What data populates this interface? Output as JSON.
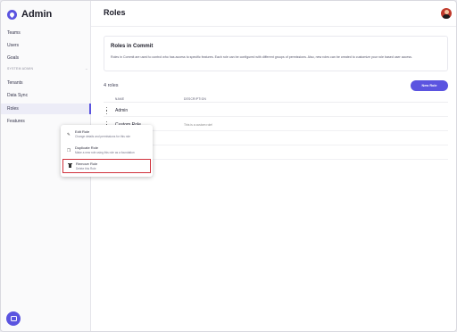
{
  "brand": {
    "name": "Admin"
  },
  "sidebar": {
    "items_top": [
      "Teams",
      "Users",
      "Goals"
    ],
    "section_label": "SYSTEM ADMIN",
    "section_chevron": "–",
    "items_admin": [
      "Tenants",
      "Data Sync",
      "Roles",
      "Features"
    ],
    "active": "Roles"
  },
  "header": {
    "title": "Roles"
  },
  "info_card": {
    "title": "Roles in Commit",
    "description": "Roles in Commit are used to control who has access to specific features. Each role can be configured with different groups of permissions. Also, new roles can be created to customize your role based user access."
  },
  "roles": {
    "count_label": "4 roles",
    "new_button": "New Role",
    "columns": [
      "NAME",
      "DESCRIPTION"
    ],
    "rows": [
      {
        "name": "Admin",
        "description": ""
      },
      {
        "name": "Custom Role",
        "description": "This is a custom role!"
      },
      {
        "name": "",
        "description": ""
      },
      {
        "name": "",
        "description": ""
      }
    ]
  },
  "context_menu": {
    "items": [
      {
        "icon": "pencil-icon",
        "title": "Edit Role",
        "subtitle": "Change details and permissions for this role"
      },
      {
        "icon": "duplicate-icon",
        "title": "Duplicate Role",
        "subtitle": "Make a new role using this role as a foundation"
      },
      {
        "icon": "trash-icon",
        "title": "Remove Role",
        "subtitle": "Delete this Role"
      }
    ]
  },
  "colors": {
    "accent": "#5b54e0",
    "highlight": "#d0303a"
  }
}
